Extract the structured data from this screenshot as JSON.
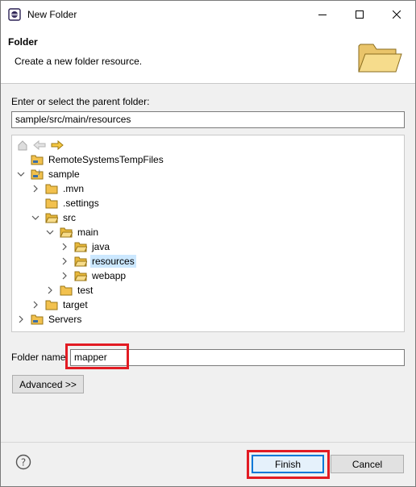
{
  "window": {
    "title": "New Folder"
  },
  "banner": {
    "title": "Folder",
    "description": "Create a new folder resource."
  },
  "parent": {
    "label": "Enter or select the parent folder:",
    "value": "sample/src/main/resources"
  },
  "tree": {
    "items": [
      {
        "label": "RemoteSystemsTempFiles",
        "expanded": null,
        "type": "project",
        "selected": false
      },
      {
        "label": "sample",
        "expanded": true,
        "type": "project-java",
        "selected": false
      },
      {
        "label": ".mvn",
        "expanded": false,
        "type": "folder",
        "selected": false
      },
      {
        "label": ".settings",
        "expanded": null,
        "type": "folder",
        "selected": false
      },
      {
        "label": "src",
        "expanded": true,
        "type": "folder",
        "selected": false
      },
      {
        "label": "main",
        "expanded": true,
        "type": "folder",
        "selected": false
      },
      {
        "label": "java",
        "expanded": false,
        "type": "folder",
        "selected": false
      },
      {
        "label": "resources",
        "expanded": false,
        "type": "folder",
        "selected": true
      },
      {
        "label": "webapp",
        "expanded": false,
        "type": "folder",
        "selected": false
      },
      {
        "label": "test",
        "expanded": false,
        "type": "folder",
        "selected": false
      },
      {
        "label": "target",
        "expanded": false,
        "type": "folder",
        "selected": false
      },
      {
        "label": "Servers",
        "expanded": false,
        "type": "project",
        "selected": false
      }
    ]
  },
  "folder_name": {
    "label": "Folder name:",
    "value": "mapper"
  },
  "advanced": {
    "label": "Advanced >>"
  },
  "footer": {
    "finish_label": "Finish",
    "cancel_label": "Cancel"
  },
  "colors": {
    "highlight": "#e21b23",
    "selection": "#cce8ff",
    "focus": "#0078d7",
    "folder": "#f2c14e"
  }
}
